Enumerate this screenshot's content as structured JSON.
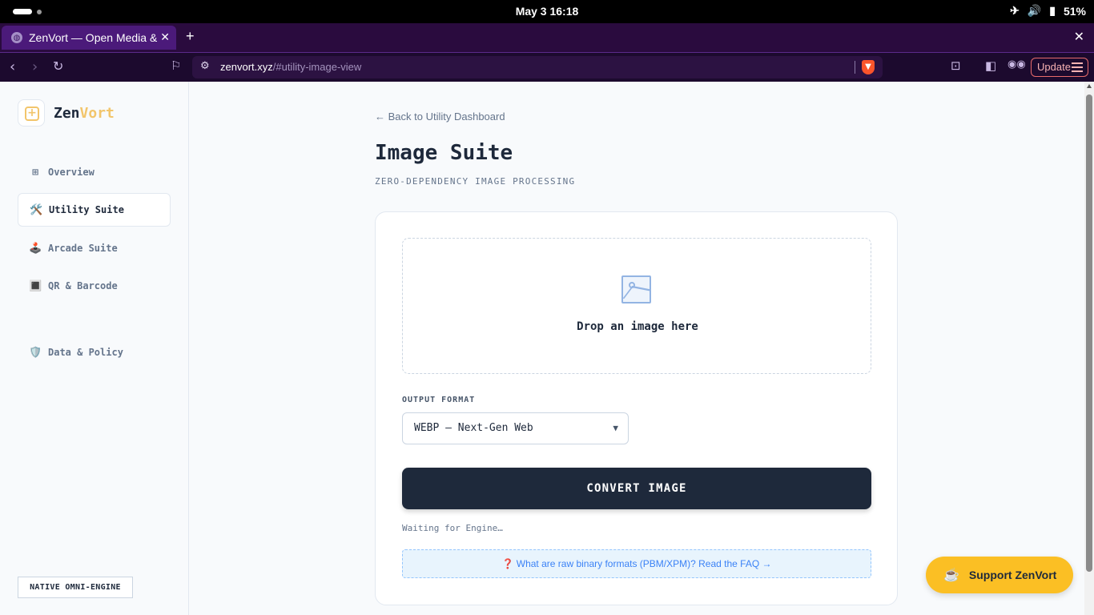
{
  "os": {
    "clock": "May 3  16:18",
    "battery": "51%"
  },
  "browser": {
    "tab_title": "ZenVort — Open Media & Tools",
    "url_host": "zenvort.xyz",
    "url_path": "/#utility-image-view",
    "update_label": "Update"
  },
  "sidebar": {
    "brand_zen": "Zen",
    "brand_vort": "Vort",
    "items": [
      {
        "icon": "⊞",
        "label": "Overview"
      },
      {
        "icon": "🛠️",
        "label": "Utility Suite"
      },
      {
        "icon": "🕹️",
        "label": "Arcade Suite"
      },
      {
        "icon": "🔳",
        "label": "QR & Barcode"
      },
      {
        "icon": "🛡️",
        "label": "Data & Policy"
      }
    ],
    "engine_badge": "NATIVE OMNI-ENGINE"
  },
  "main": {
    "back_link": "← Back to Utility Dashboard",
    "title": "Image Suite",
    "subtitle": "ZERO-DEPENDENCY IMAGE PROCESSING",
    "dropzone_text": "Drop an image here",
    "format_label": "OUTPUT FORMAT",
    "format_selected": "WEBP — Next-Gen Web",
    "convert_label": "CONVERT IMAGE",
    "status": "Waiting for Engine…",
    "faq_icon": "❓",
    "faq_text": "What are raw binary formats (PBM/XPM)? Read the FAQ →"
  },
  "support_button": "Support ZenVort"
}
